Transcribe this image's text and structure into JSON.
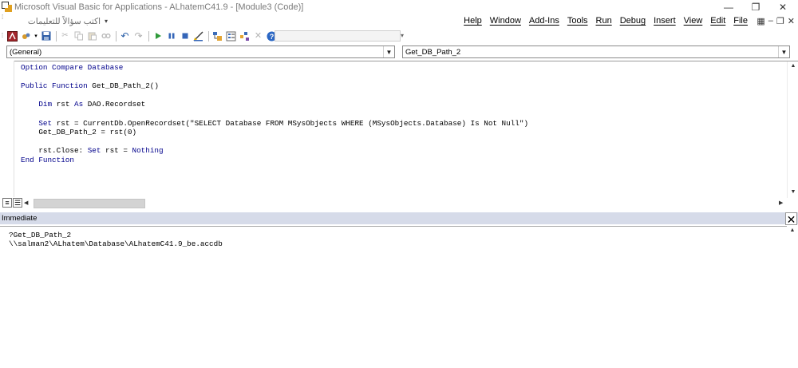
{
  "window": {
    "title": "Microsoft Visual Basic for Applications - ALhatemC41.9 - [Module3 (Code)]",
    "minimize_glyph": "—",
    "restore_glyph": "❐",
    "close_glyph": "✕"
  },
  "help_box": {
    "placeholder": "اكتب سؤالاً للتعليمات"
  },
  "menu": {
    "items": [
      "Help",
      "Window",
      "Add-Ins",
      "Tools",
      "Run",
      "Debug",
      "Insert",
      "View",
      "Edit",
      "File"
    ],
    "mdi_minimize": "–",
    "mdi_restore": "❐",
    "mdi_close": "✕"
  },
  "toolbar": {
    "icons": [
      "access-icon",
      "insert-module-icon",
      "save-icon",
      "cut-icon",
      "copy-icon",
      "paste-icon",
      "find-icon",
      "undo-icon",
      "redo-icon",
      "run-icon",
      "break-icon",
      "reset-icon",
      "design-mode-icon",
      "project-explorer-icon",
      "properties-icon",
      "object-browser-icon",
      "toolbox-icon",
      "help-icon"
    ]
  },
  "combos": {
    "object": "(General)",
    "procedure": "Get_DB_Path_2"
  },
  "code": {
    "lines": [
      [
        {
          "t": "Option Compare Database",
          "k": true
        }
      ],
      [],
      [
        {
          "t": "Public Function",
          "k": true
        },
        {
          "t": " Get_DB_Path_2()",
          "k": false
        }
      ],
      [],
      [
        {
          "t": "    ",
          "k": false
        },
        {
          "t": "Dim",
          "k": true
        },
        {
          "t": " rst ",
          "k": false
        },
        {
          "t": "As",
          "k": true
        },
        {
          "t": " DAO.Recordset",
          "k": false
        }
      ],
      [],
      [
        {
          "t": "    ",
          "k": false
        },
        {
          "t": "Set",
          "k": true
        },
        {
          "t": " rst = CurrentDb.OpenRecordset(\"SELECT Database FROM MSysObjects WHERE (MSysObjects.Database) Is Not Null\")",
          "k": false
        }
      ],
      [
        {
          "t": "    Get_DB_Path_2 = rst(0)",
          "k": false
        }
      ],
      [],
      [
        {
          "t": "    rst.Close: ",
          "k": false
        },
        {
          "t": "Set",
          "k": true
        },
        {
          "t": " rst = ",
          "k": false
        },
        {
          "t": "Nothing",
          "k": true
        }
      ],
      [
        {
          "t": "End Function",
          "k": true
        }
      ]
    ]
  },
  "immediate": {
    "title": "Immediate",
    "close_glyph": "✕",
    "lines": [
      "?Get_DB_Path_2",
      "\\\\salman2\\ALhatem\\Database\\ALhatemC41.9_be.accdb"
    ]
  },
  "colors": {
    "keyword": "#00008b",
    "immediate_header": "#d6dbe9"
  }
}
